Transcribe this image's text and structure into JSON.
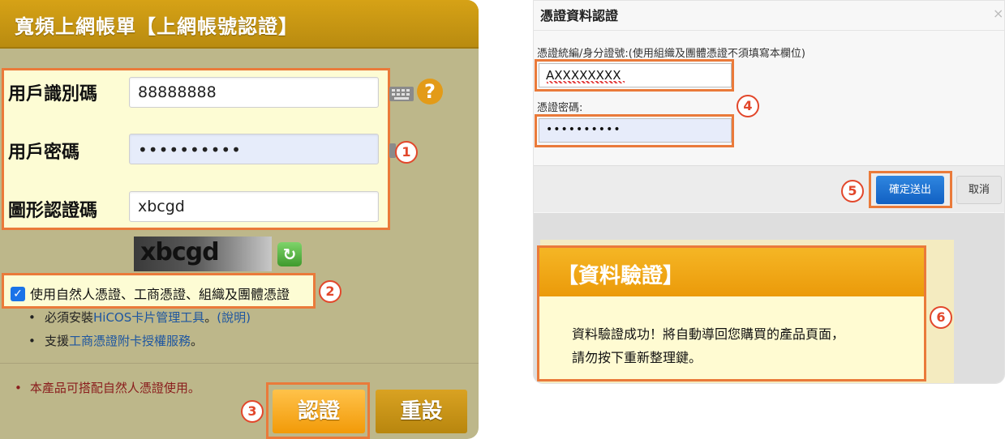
{
  "left": {
    "title": "寬頻上網帳單【上網帳號認證】",
    "user_id_label": "用戶識別碼",
    "user_id_value": "88888888",
    "password_label": "用戶密碼",
    "password_value": "••••••••••",
    "captcha_label": "圖形認證碼",
    "captcha_value": "xbcgd",
    "captcha_image_text": "xbcgd",
    "help_icon": "?",
    "refresh_icon": "↻",
    "checkbox_label": "使用自然人憑證、工商憑證、組織及團體憑證",
    "bullet1_prefix": "必須安裝",
    "bullet1_link": "HiCOS卡片管理工具",
    "bullet1_mid": "。",
    "bullet1_link2": "(說明)",
    "bullet2_prefix": "支援",
    "bullet2_link": "工商憑證附卡授權服務",
    "bullet2_suffix": "。",
    "note": "本產品可搭配自然人憑證使用。",
    "auth_button": "認證",
    "reset_button": "重設"
  },
  "right": {
    "dialog_title": "憑證資料認證",
    "close_icon": "×",
    "id_label": "憑證統編/身分證號",
    "id_note": ":(使用組織及團體憑證不須填寫本欄位)",
    "id_value": "AXXXXXXXX",
    "pin_label": "憑證密碼:",
    "pin_value": "••••••••••",
    "ok_button": "確定送出",
    "cancel_button": "取消",
    "verify_title": "【資料驗證】",
    "verify_line1": "資料驗證成功！將自動導回您購買的產品頁面，",
    "verify_line2": "請勿按下重新整理鍵。"
  },
  "badges": [
    "1",
    "2",
    "3",
    "4",
    "5",
    "6"
  ],
  "colors": {
    "highlight_border": "#ea7a3a",
    "badge_red": "#e2472b",
    "gold": "#d6a216",
    "blue_button": "#1160c2"
  }
}
